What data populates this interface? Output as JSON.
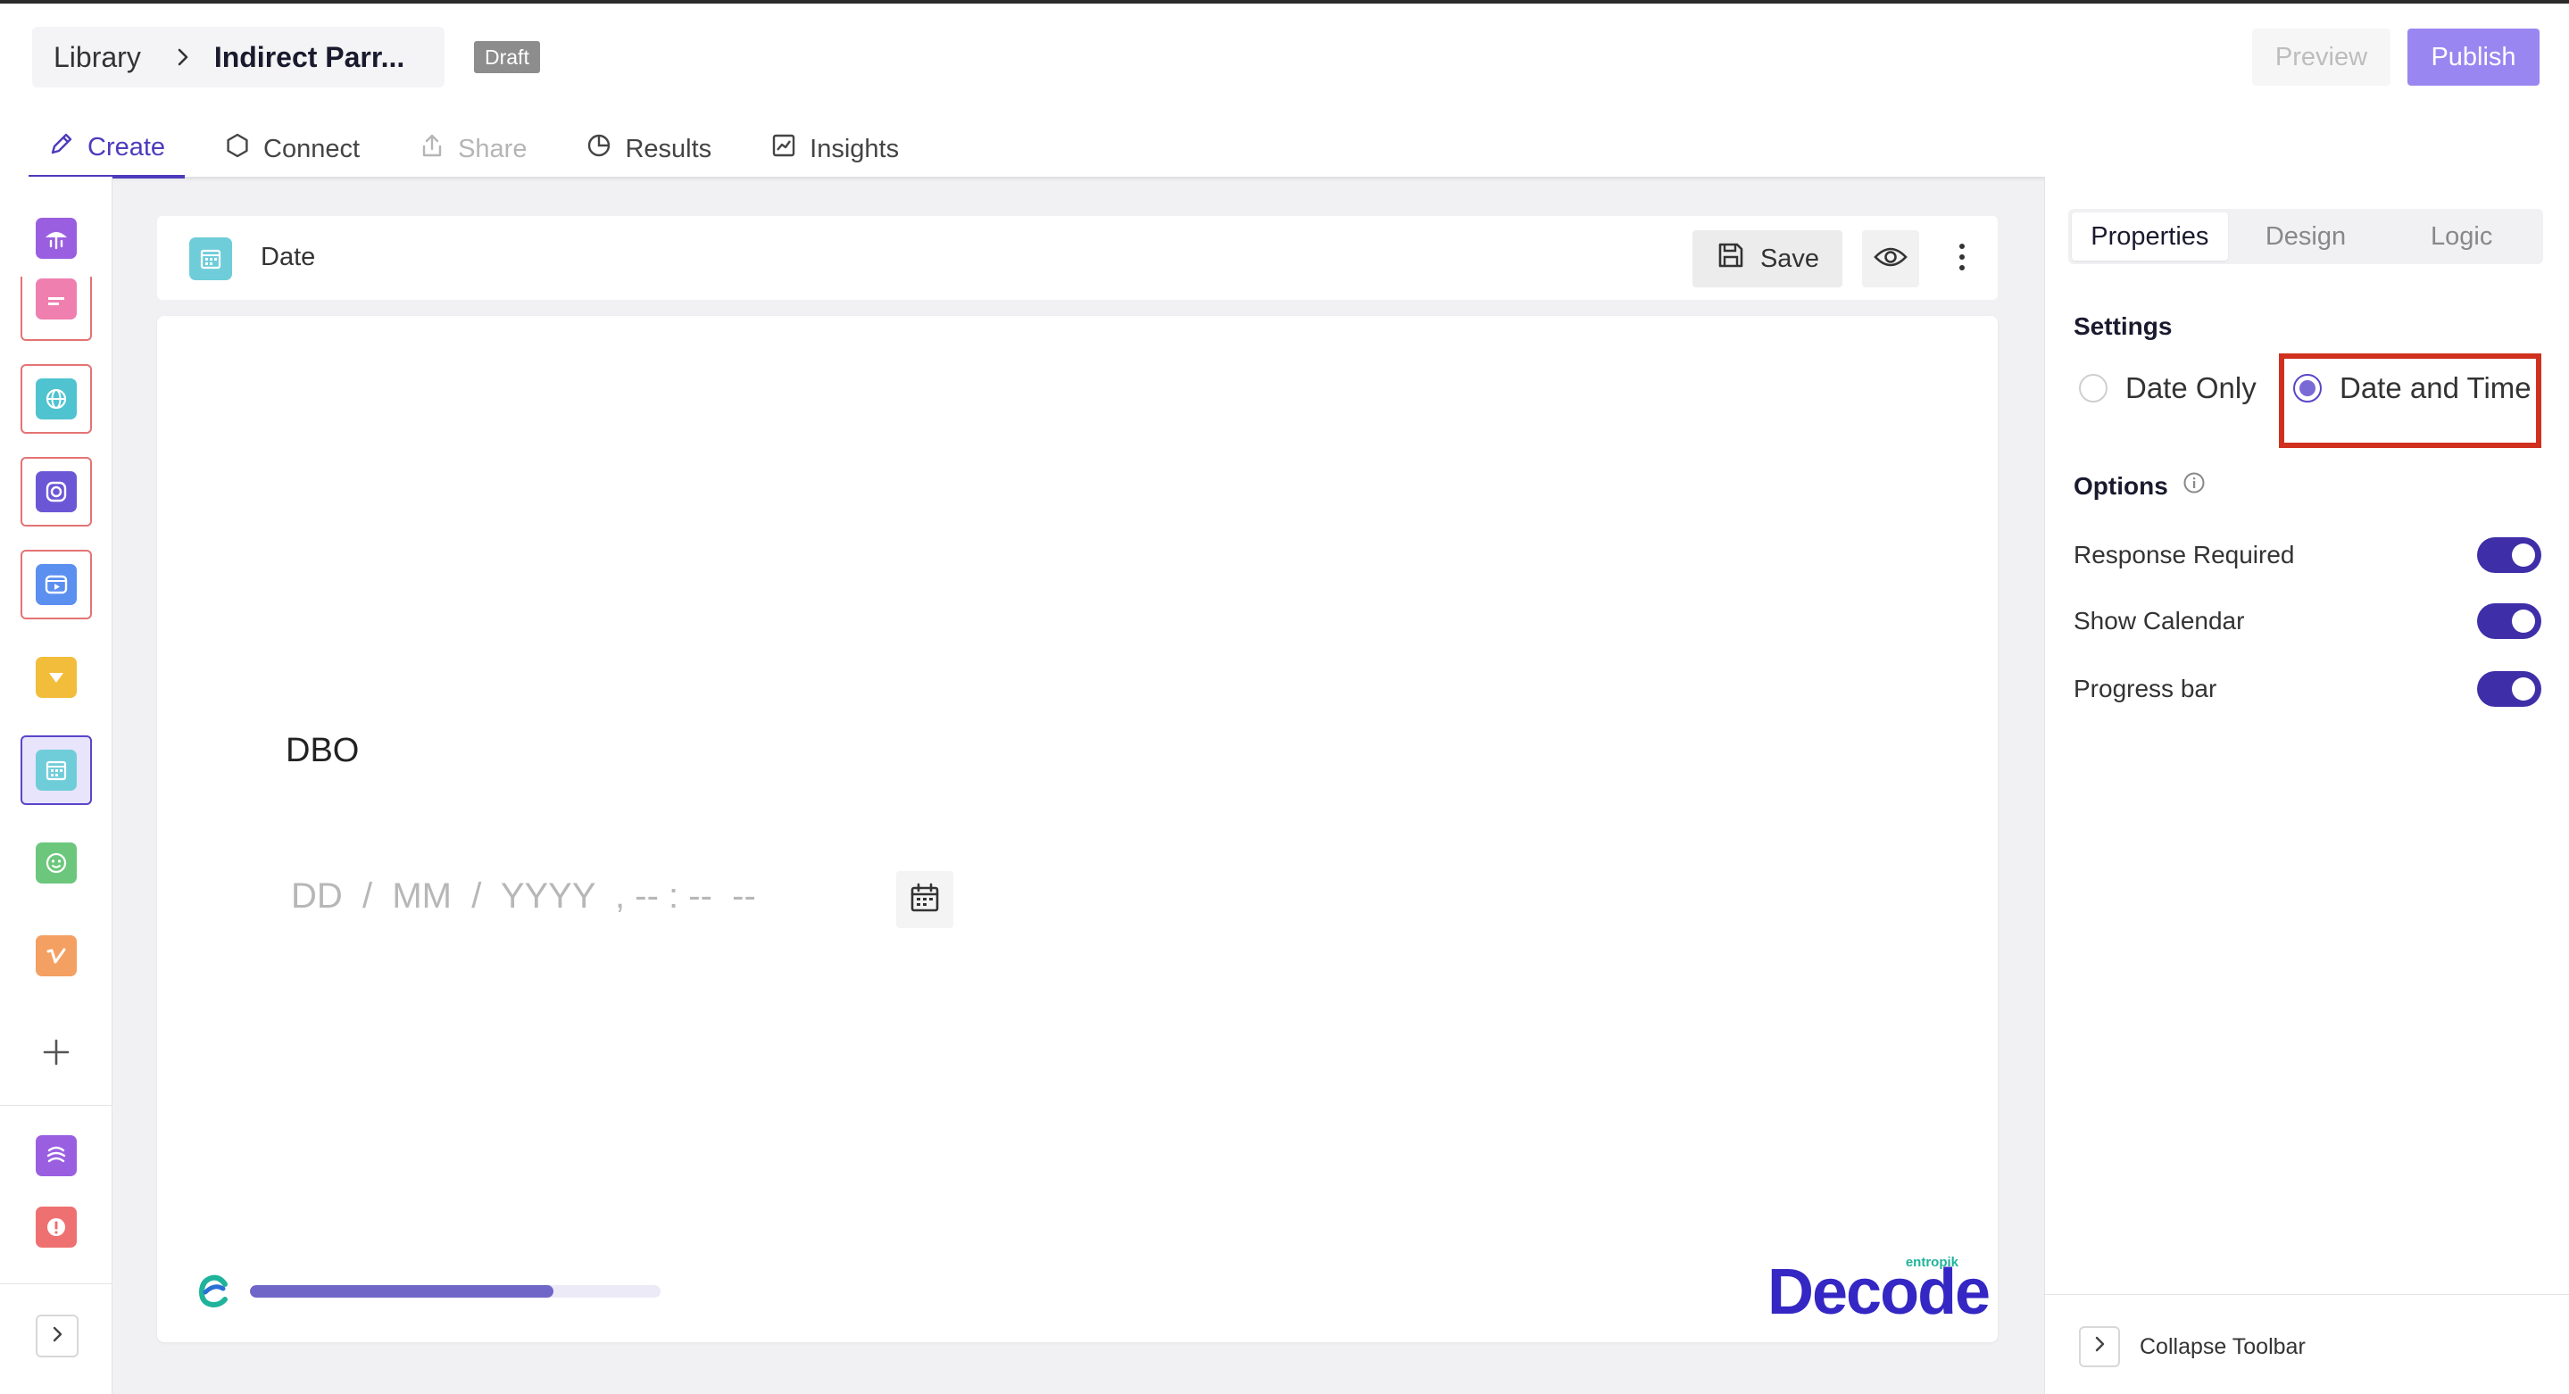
{
  "header": {
    "breadcrumb_root": "Library",
    "breadcrumb_title": "Indirect Parr...",
    "status_badge": "Draft",
    "preview_label": "Preview",
    "publish_label": "Publish"
  },
  "tabs": [
    {
      "label": "Create",
      "icon": "pencil-icon",
      "state": "active"
    },
    {
      "label": "Connect",
      "icon": "hexagon-icon",
      "state": "normal"
    },
    {
      "label": "Share",
      "icon": "share-icon",
      "state": "disabled"
    },
    {
      "label": "Results",
      "icon": "pie-chart-icon",
      "state": "normal"
    },
    {
      "label": "Insights",
      "icon": "line-chart-icon",
      "state": "normal"
    }
  ],
  "sidebar": {
    "blocks": [
      {
        "icon": "welcome-block-icon",
        "color": "#9a5fe0",
        "state": "normal"
      },
      {
        "icon": "text-block-icon",
        "color": "#ef7fae",
        "state": "error"
      },
      {
        "icon": "website-block-icon",
        "color": "#4fc3cf",
        "state": "error"
      },
      {
        "icon": "instagram-block-icon",
        "color": "#6b57d6",
        "state": "error"
      },
      {
        "icon": "video-block-icon",
        "color": "#5b8ff0",
        "state": "error"
      },
      {
        "icon": "dropdown-block-icon",
        "color": "#f2bd3a",
        "state": "normal"
      },
      {
        "icon": "date-block-icon",
        "color": "#6fcdd9",
        "state": "selected"
      },
      {
        "icon": "smiley-block-icon",
        "color": "#6cc77c",
        "state": "normal"
      },
      {
        "icon": "vimeo-block-icon",
        "color": "#f4a062",
        "state": "normal"
      },
      {
        "icon": "add-block-icon",
        "color": "#555555",
        "state": "normal"
      },
      {
        "icon": "end-screen-icon",
        "color": "#9a5fe0",
        "state": "normal"
      },
      {
        "icon": "disqualify-icon",
        "color": "#ef7070",
        "state": "normal"
      }
    ],
    "expand_icon": "chevron-right-icon"
  },
  "question": {
    "type_label": "Date",
    "save_label": "Save",
    "text": "DBO",
    "date_placeholder": "DD  /  MM  /  YYYY  , -- : --  --",
    "progress_fraction": 0.74,
    "brand_small": "entropik",
    "brand_word": "Decode"
  },
  "properties": {
    "tabs": [
      "Properties",
      "Design",
      "Logic"
    ],
    "active_tab": "Properties",
    "settings_title": "Settings",
    "radio_options": [
      {
        "label": "Date Only",
        "selected": false
      },
      {
        "label": "Date and Time",
        "selected": true
      }
    ],
    "options_title": "Options",
    "toggles": [
      {
        "label": "Response Required",
        "on": true
      },
      {
        "label": "Show Calendar",
        "on": true
      },
      {
        "label": "Progress bar",
        "on": true
      }
    ],
    "collapse_label": "Collapse Toolbar"
  },
  "colors": {
    "accent": "#4c3bbd",
    "publish": "#9a86f0",
    "toggle_on": "#3e2fa8",
    "highlight": "#d0301e",
    "progress": "#6f66c8"
  }
}
